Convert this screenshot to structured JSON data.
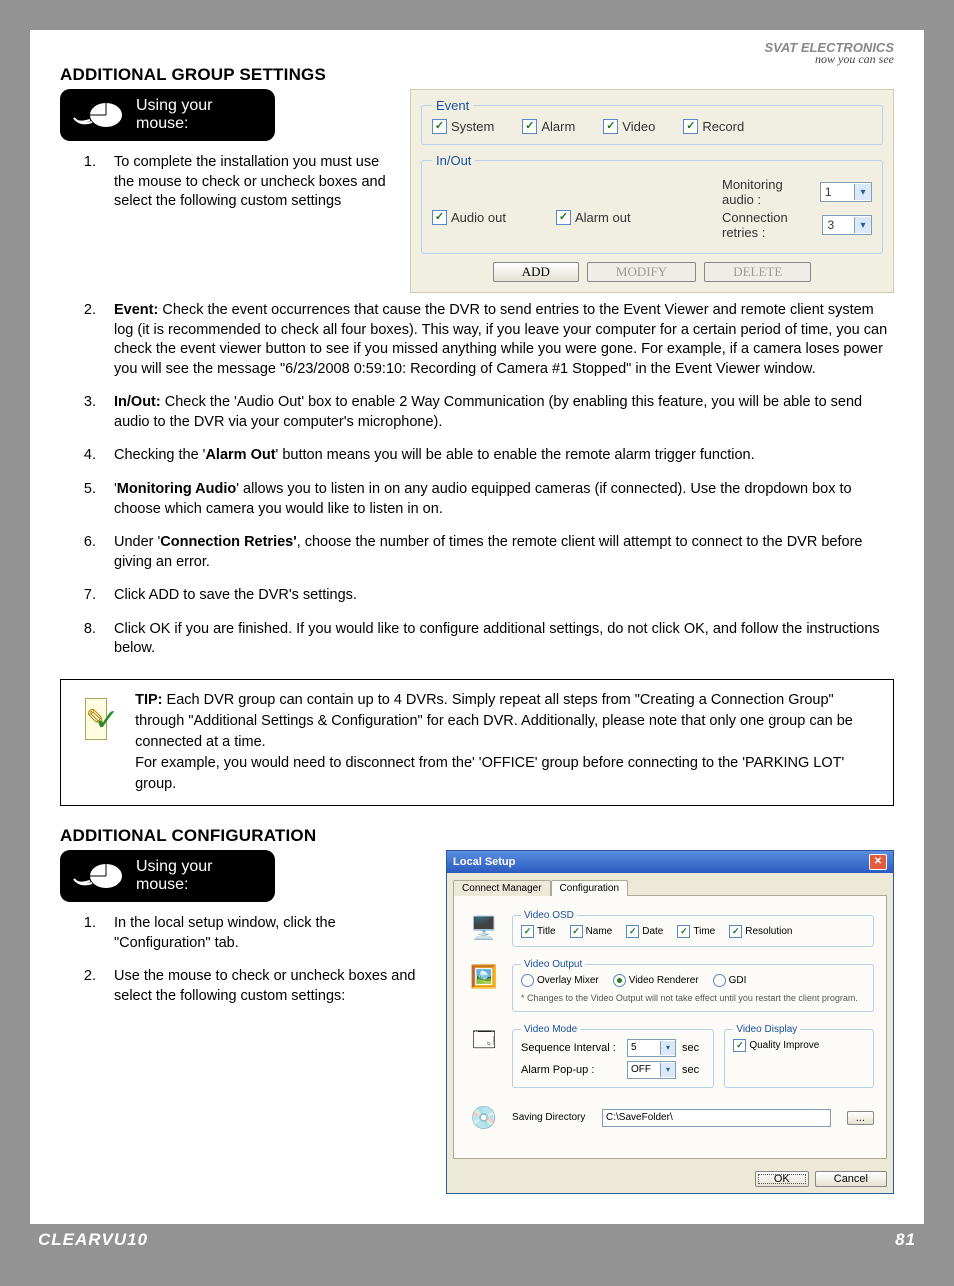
{
  "brand": "SVAT ELECTRONICS",
  "tagline": "now you can see",
  "section1_title": "ADDITIONAL GROUP SETTINGS",
  "mouse_badge": "Using your mouse:",
  "step1": "To complete the installation you must use the mouse to check or uncheck boxes and select the following custom settings",
  "event_panel": {
    "legend": "Event",
    "chk1": "System",
    "chk2": "Alarm",
    "chk3": "Video",
    "chk4": "Record"
  },
  "inout_panel": {
    "legend": "In/Out",
    "chk1": "Audio out",
    "chk2": "Alarm out",
    "mon_label": "Monitoring audio :",
    "mon_val": "1",
    "retry_label": "Connection retries :",
    "retry_val": "3"
  },
  "btns": {
    "add": "ADD",
    "mod": "MODIFY",
    "del": "DELETE"
  },
  "step2_lead": "Event:",
  "step2_body": "  Check the event occurrences that cause the DVR to send entries to the Event Viewer and remote client system log (it is recommended to check all four boxes).  This way, if you leave your computer for a certain period of time, you can check the event viewer button to see if you missed anything while you were gone.  For example, if a camera loses power you will see the message \"6/23/2008 0:59:10:  Recording of Camera #1 Stopped\" in the Event Viewer window.",
  "step3_lead": "In/Out:",
  "step3_body": "  Check the 'Audio Out' box to enable 2 Way Communication (by enabling this feature, you will be able to send audio to the DVR via your computer's microphone).",
  "step4_a": "Checking the '",
  "step4_b": "Alarm Out",
  "step4_c": "' button means you will be able to enable the remote alarm trigger function.",
  "step5_a": "'",
  "step5_b": "Monitoring Audio",
  "step5_c": "' allows you to listen in on any audio equipped cameras (if connected).  Use the dropdown box to choose which camera you would like to listen in on.",
  "step6_a": "Under '",
  "step6_b": "Connection Retries'",
  "step6_c": ", choose the number of times the remote client will attempt to connect to the DVR before giving an error.",
  "step7": "Click ADD to save the DVR's settings.",
  "step8": "Click OK if you are finished.  If you would like to configure additional settings, do not click OK, and follow the instructions below.",
  "tip_lead": "TIP:",
  "tip_body": "  Each DVR group can contain up to 4 DVRs.  Simply repeat all steps from \"Creating a Connection Group\" through \"Additional Settings & Configuration\" for each DVR.  Additionally, please note that only one group can be connected at a time.",
  "tip_body2": "For example, you would need to disconnect from the' 'OFFICE' group before connecting to the 'PARKING LOT' group.",
  "section2_title": "ADDITIONAL CONFIGURATION",
  "cfg_step1": "In the local setup window, click the \"Configuration\" tab.",
  "cfg_step2": "Use the mouse to check or uncheck boxes and select the following custom settings:",
  "local_setup": {
    "title": "Local Setup",
    "tab1": "Connect Manager",
    "tab2": "Configuration",
    "video_osd": {
      "legend": "Video OSD",
      "c1": "Title",
      "c2": "Name",
      "c3": "Date",
      "c4": "Time",
      "c5": "Resolution"
    },
    "video_output": {
      "legend": "Video Output",
      "r1": "Overlay Mixer",
      "r2": "Video Renderer",
      "r3": "GDI",
      "note": "* Changes to the Video Output will not take effect until you restart the client program."
    },
    "video_mode": {
      "legend": "Video Mode",
      "l1": "Sequence Interval :",
      "v1": "5",
      "u1": "sec",
      "l2": "Alarm Pop-up :",
      "v2": "OFF",
      "u2": "sec"
    },
    "video_display": {
      "legend": "Video Display",
      "c1": "Quality Improve"
    },
    "savedir_label": "Saving Directory",
    "savedir_val": "C:\\SaveFolder\\",
    "browse": "...",
    "ok": "OK",
    "cancel": "Cancel"
  },
  "footer_left": "CLEARVU10",
  "footer_right": "81"
}
